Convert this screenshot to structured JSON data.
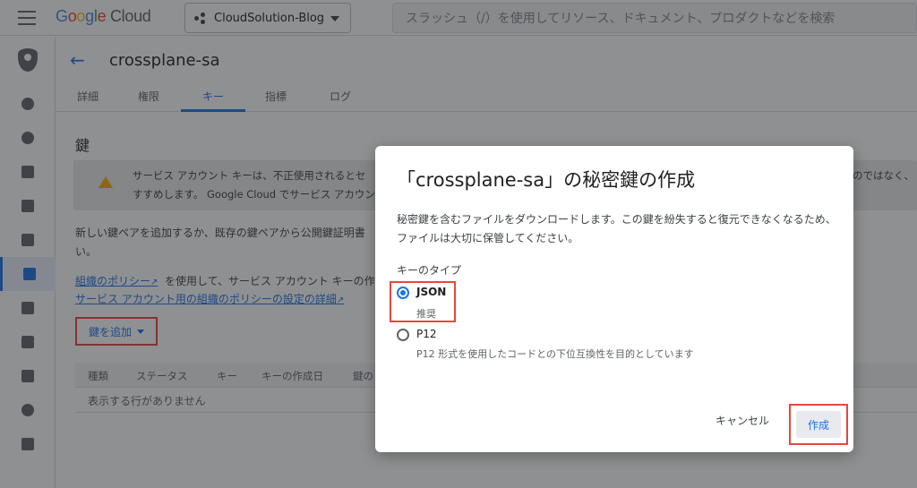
{
  "topbar": {
    "logo": {
      "g1": "G",
      "o1": "o",
      "o2": "o",
      "g2": "g",
      "l": "l",
      "e": "e",
      "cloud": " Cloud"
    },
    "project_name": "CloudSolution-Blog",
    "search_placeholder": "スラッシュ（/）を使用してリソース、ドキュメント、プロダクトなどを検索"
  },
  "page": {
    "title": "crossplane-sa",
    "tabs": [
      {
        "label": "詳細"
      },
      {
        "label": "権限"
      },
      {
        "label": "キー"
      },
      {
        "label": "指標"
      },
      {
        "label": "ログ"
      }
    ],
    "active_tab": "キー",
    "section_title": "鍵",
    "warning": {
      "line1": "サービス アカウント キーは、不正使用されるとセ",
      "line2": "すすめします。 Google Cloud でサービス アカウン",
      "tail": "のではなく、"
    },
    "description_line1": "新しい鍵ペアを追加するか、既存の鍵ペアから公開鍵証明書",
    "description_line2": "い。",
    "policy_link": "組織のポリシー",
    "policy_rest": "を使用して、サービス アカウント キーの作",
    "policy_detail_link": "サービス アカウント用の組織のポリシーの設定の詳細",
    "add_key_label": "鍵を追加",
    "table_headers": [
      "種類",
      "ステータス",
      "キー",
      "キーの作成日",
      "鍵の"
    ],
    "empty_text": "表示する行がありません"
  },
  "dialog": {
    "title": "「crossplane-sa」の秘密鍵の作成",
    "description": "秘密鍵を含むファイルをダウンロードします。この鍵を紛失すると復元できなくなるため、ファイルは大切に保管してください。",
    "key_type_label": "キーのタイプ",
    "options": [
      {
        "label": "JSON",
        "sub": "推奨",
        "checked": true
      },
      {
        "label": "P12",
        "sub": "P12 形式を使用したコードとの下位互換性を目的としています",
        "checked": false
      }
    ],
    "cancel_label": "キャンセル",
    "create_label": "作成"
  },
  "colors": {
    "accent": "#1a73e8",
    "highlight": "#e8453c",
    "warning": "#f9ab00"
  }
}
